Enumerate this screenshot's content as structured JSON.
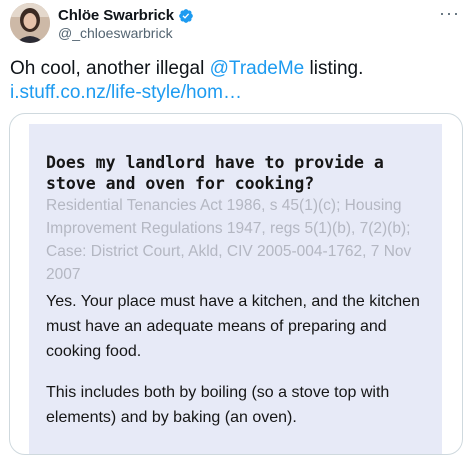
{
  "author": {
    "name": "Chlöe Swarbrick",
    "handle": "@_chloeswarbrick",
    "avatar_icon": "avatar-photo",
    "verified_icon": "verified-badge-icon",
    "verified_color": "#1d9bf0"
  },
  "more_label": "···",
  "tweet": {
    "text_before": "Oh cool, another illegal ",
    "mention": "@TradeMe",
    "text_middle": " listing. ",
    "link": "i.stuff.co.nz/life-style/hom…"
  },
  "card": {
    "question": "Does my landlord have to provide a stove and oven for cooking?",
    "citation": "Residential Tenancies Act 1986, s 45(1)(c); Housing Improvement Regulations 1947, regs 5(1)(b), 7(2)(b); Case: District Court, Akld, CIV 2005-004-1762, 7 Nov 2007",
    "paragraph1": "Yes. Your place must have a kitchen, and the kitchen must have an adequate means of preparing and cooking food.",
    "paragraph2": "This includes both by boiling (so a stove top with elements) and by baking (an oven)."
  },
  "colors": {
    "link": "#1d9bf0",
    "card_background": "#e7eaf7",
    "citation_text": "#b4b7c2"
  }
}
